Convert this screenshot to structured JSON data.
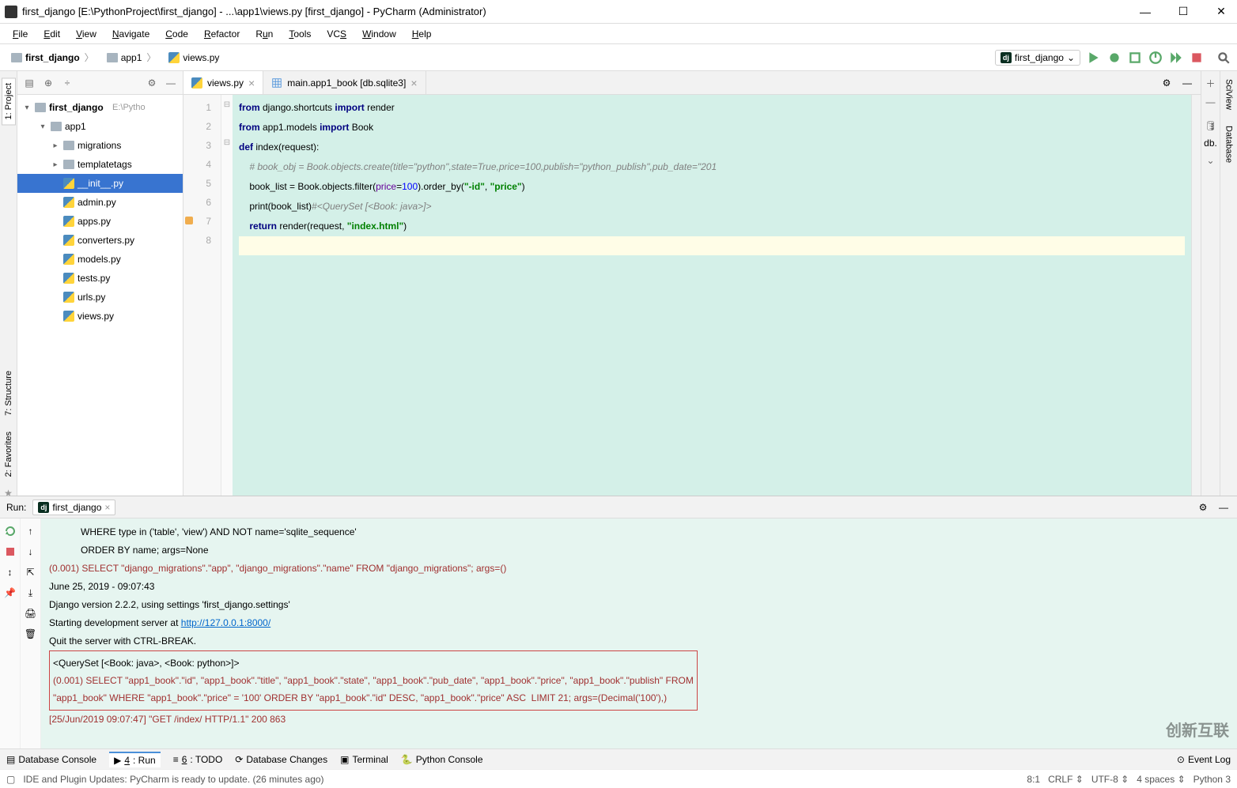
{
  "window": {
    "title": "first_django [E:\\PythonProject\\first_django] - ...\\app1\\views.py [first_django] - PyCharm (Administrator)"
  },
  "menu": {
    "file": "File",
    "edit": "Edit",
    "view": "View",
    "navigate": "Navigate",
    "code": "Code",
    "refactor": "Refactor",
    "run": "Run",
    "tools": "Tools",
    "vcs": "VCS",
    "window": "Window",
    "help": "Help"
  },
  "breadcrumb": {
    "root": "first_django",
    "app": "app1",
    "file": "views.py"
  },
  "run_config": {
    "name": "first_django"
  },
  "project": {
    "root": "first_django",
    "root_path": "E:\\Pytho",
    "app1": "app1",
    "migrations": "migrations",
    "templatetags": "templatetags",
    "init": "__init__.py",
    "admin": "admin.py",
    "apps": "apps.py",
    "converters": "converters.py",
    "models": "models.py",
    "tests": "tests.py",
    "urls": "urls.py",
    "views_trunc": "views.py"
  },
  "tabs": {
    "views": "views.py",
    "db": "main.app1_book [db.sqlite3]"
  },
  "code": {
    "l1a": "from",
    "l1b": " django.shortcuts ",
    "l1c": "import",
    "l1d": " render",
    "l2a": "from",
    "l2b": " app1.models ",
    "l2c": "import",
    "l2d": " Book",
    "l3a": "def ",
    "l3b": "index(request):",
    "l4": "    # book_obj = Book.objects.create(title=\"python\",state=True,price=100,publish=\"python_publish\",pub_date=\"201",
    "l5a": "    book_list = Book.objects.filter(",
    "l5b": "price",
    "l5c": "=",
    "l5d": "100",
    "l5e": ").order_by(",
    "l5f": "\"-id\"",
    "l5g": ", ",
    "l5h": "\"price\"",
    "l5i": ")",
    "l6a": "    print(book_list)",
    "l6b": "#<QuerySet [<Book: java>]>",
    "l7a": "    ",
    "l7b": "return ",
    "l7c": "render(request, ",
    "l7d": "\"index.html\"",
    "l7e": ")"
  },
  "run": {
    "label": "Run:",
    "tab_name": "first_django",
    "console_lines": {
      "pre1": "            WHERE type in ('table', 'view') AND NOT name='sqlite_sequence'",
      "pre2": "            ORDER BY name; args=None",
      "sel1": "(0.001) SELECT \"django_migrations\".\"app\", \"django_migrations\".\"name\" FROM \"django_migrations\"; args=()",
      "date": "June 25, 2019 - 09:07:43",
      "ver": "Django version 2.2.2, using settings 'first_django.settings'",
      "srv_a": "Starting development server at ",
      "srv_b": "http://127.0.0.1:8000/",
      "quit": "Quit the server with CTRL-BREAK.",
      "qs": "<QuerySet [<Book: java>, <Book: python>]>",
      "sel2a": "(0.001) SELECT \"app1_book\".\"id\", \"app1_book\".\"title\", \"app1_book\".\"state\", \"app1_book\".\"pub_date\", \"app1_book\".\"price\", \"app1_book\".\"publish\" FROM",
      "sel2b": "\"app1_book\" WHERE \"app1_book\".\"price\" = '100' ORDER BY \"app1_book\".\"id\" DESC, \"app1_book\".\"price\" ASC  LIMIT 21; args=(Decimal('100'),)",
      "http": "[25/Jun/2019 09:07:47] \"GET /index/ HTTP/1.1\" 200 863"
    }
  },
  "bottom": {
    "db_console": "Database Console",
    "run": "4: Run",
    "todo": "6: TODO",
    "db_changes": "Database Changes",
    "terminal": "Terminal",
    "py_console": "Python Console",
    "event_log": "Event Log"
  },
  "status": {
    "msg": "IDE and Plugin Updates: PyCharm is ready to update. (26 minutes ago)",
    "pos": "8:1",
    "crlf": "CRLF",
    "enc": "UTF-8",
    "indent": "4 spaces",
    "interp": "Python 3"
  },
  "sidetabs": {
    "project": "1: Project",
    "structure": "7: Structure",
    "favorites": "2: Favorites",
    "sciview": "SciView",
    "database": "Database",
    "db_short": "db."
  }
}
